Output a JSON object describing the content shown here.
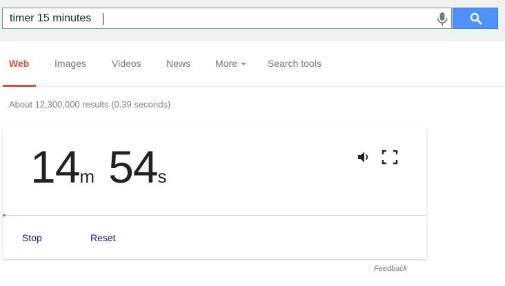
{
  "search": {
    "query": "timer 15 minutes"
  },
  "tabs": [
    {
      "label": "Web"
    },
    {
      "label": "Images"
    },
    {
      "label": "Videos"
    },
    {
      "label": "News"
    },
    {
      "label": "More"
    },
    {
      "label": "Search tools"
    }
  ],
  "result_stats": "About 12,300,000 results (0.39 seconds)",
  "timer": {
    "minutes": "14",
    "minutes_unit": "m",
    "seconds": "54",
    "seconds_unit": "s",
    "progress_fraction": 0.0067,
    "stop_label": "Stop",
    "reset_label": "Reset"
  },
  "feedback_label": "Feedback",
  "colors": {
    "accent_blue": "#4d90fe",
    "active_tab_red": "#dd4b39",
    "link_blue": "#1a0dab"
  }
}
